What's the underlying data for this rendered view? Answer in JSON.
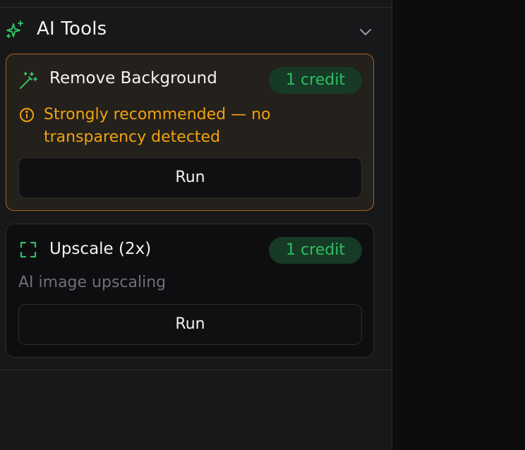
{
  "section": {
    "title": "AI Tools",
    "icon": "sparkle-icon"
  },
  "cards": [
    {
      "title": "Remove Background",
      "icon": "magic-wand-icon",
      "credit": "1 credit",
      "warning": "Strongly recommended — no transparency detected",
      "run_label": "Run"
    },
    {
      "title": "Upscale (2x)",
      "icon": "expand-frame-icon",
      "credit": "1 credit",
      "description": "AI image upscaling",
      "run_label": "Run"
    }
  ],
  "colors": {
    "accent_green": "#2fbf63",
    "warning_orange": "#f0a30f",
    "warning_border": "#a5651b"
  }
}
